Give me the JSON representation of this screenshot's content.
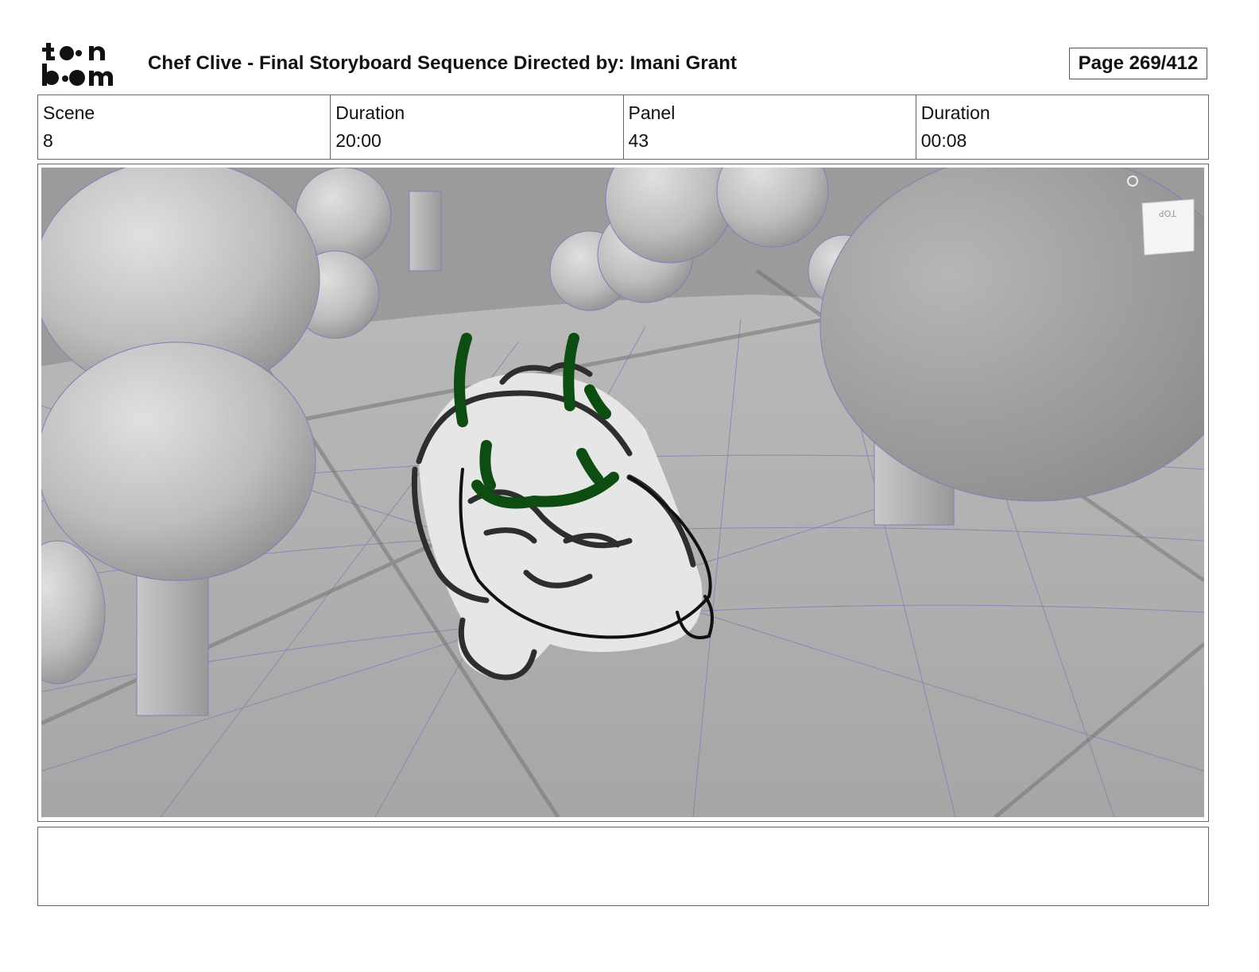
{
  "header": {
    "title": "Chef Clive - Final Storyboard Sequence  Directed by: Imani Grant",
    "page": "Page 269/412"
  },
  "logo": {
    "icon": "toon-boom-logo",
    "text": "toon boom"
  },
  "info": [
    {
      "label": "Scene",
      "value": "8"
    },
    {
      "label": "Duration",
      "value": "20:00"
    },
    {
      "label": "Panel",
      "value": "43"
    },
    {
      "label": "Duration",
      "value": "00:08"
    }
  ],
  "panel": {
    "description_icon": "storyboard-sketch",
    "view_cube_label": "TOP"
  },
  "notes": "",
  "colors": {
    "sketch_green": "#0d4d12",
    "scene_gray": "#b4b4b4",
    "wireframe": "#7d80b8"
  }
}
